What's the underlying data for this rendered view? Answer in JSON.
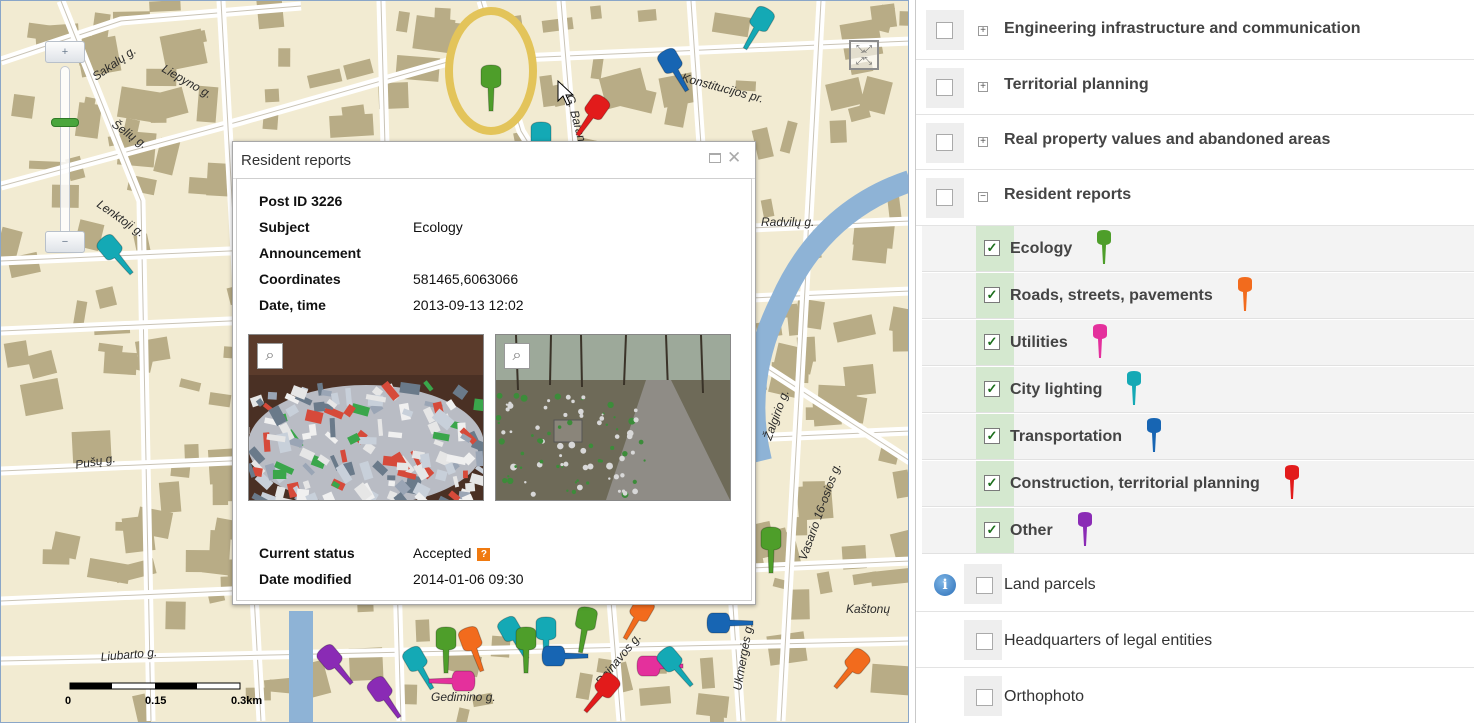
{
  "map": {
    "zoom_in_label": "+",
    "zoom_out_label": "−",
    "fullscreen_icon": "fullscreen-icon",
    "street_labels": [
      "Sakalų g.",
      "Liepyno g.",
      "Šelių g.",
      "Lenktoji g.",
      "Konstitucijos pr.",
      "G. Baranausko g.",
      "Pušų g.",
      "Liubarto g.",
      "Kaštonų",
      "Vasario 16-osios g.",
      "Dainavos g.",
      "Gedimino g.",
      "Ukmergės g.",
      "Radvilų g.",
      "Žalgirio g."
    ],
    "scale": {
      "labels": [
        "0",
        "0.15",
        "0.3km"
      ]
    }
  },
  "popup": {
    "title": "Resident reports",
    "fields": [
      {
        "key": "Post ID 3226",
        "value": ""
      },
      {
        "key": "Subject",
        "value": "Ecology"
      },
      {
        "key": "Announcement",
        "value": ""
      },
      {
        "key": "Coordinates",
        "value": "581465,6063066"
      },
      {
        "key": "Date, time",
        "value": "2013-09-13 12:02"
      }
    ],
    "status_label": "Current status",
    "status_value": "Accepted",
    "status_help": "?",
    "modified_label": "Date modified",
    "modified_value": "2014-01-06 09:30",
    "attachment_icon": "paperclip-icon"
  },
  "layers": {
    "groups": [
      {
        "label": "Engineering infrastructure and communication",
        "expander": "+"
      },
      {
        "label": "Territorial planning",
        "expander": "+"
      },
      {
        "label": "Real property values and abandoned areas",
        "expander": "+"
      },
      {
        "label": "Resident reports",
        "expander": "−"
      }
    ],
    "report_types": [
      {
        "label": "Ecology",
        "color": "#4e9e2a"
      },
      {
        "label": "Roads, streets, pavements",
        "color": "#f26b1d"
      },
      {
        "label": "Utilities",
        "color": "#e4309c"
      },
      {
        "label": "City lighting",
        "color": "#14a9b5"
      },
      {
        "label": "Transportation",
        "color": "#1765b3"
      },
      {
        "label": "Construction, territorial planning",
        "color": "#e21b1b"
      },
      {
        "label": "Other",
        "color": "#8a2bb5"
      }
    ],
    "other_layers": [
      {
        "label": "Land parcels"
      },
      {
        "label": "Headquarters of legal entities"
      },
      {
        "label": "Orthophoto"
      }
    ],
    "check_mark": "✓",
    "info_glyph": "i"
  }
}
